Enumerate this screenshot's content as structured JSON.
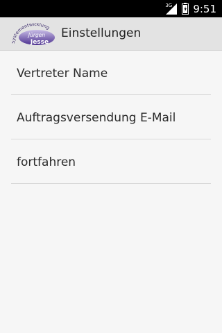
{
  "status_bar": {
    "network_type": "3G",
    "signal_icon": "signal-icon",
    "battery_icon": "battery-icon",
    "time": "9:51"
  },
  "action_bar": {
    "logo": {
      "arc_text": "Systementwicklung",
      "name_top": "Jürgen",
      "name_bottom": "Jesse"
    },
    "title": "Einstellungen"
  },
  "settings": {
    "items": [
      {
        "label": "Vertreter Name"
      },
      {
        "label": "Auftragsversendung E-Mail"
      },
      {
        "label": "fortfahren"
      }
    ]
  },
  "colors": {
    "status_bar_bg": "#000000",
    "action_bar_bg": "#e3e3e3",
    "page_bg": "#f6f6f6",
    "divider": "#d9d9d9",
    "logo_purple": "#5a3b9c"
  }
}
